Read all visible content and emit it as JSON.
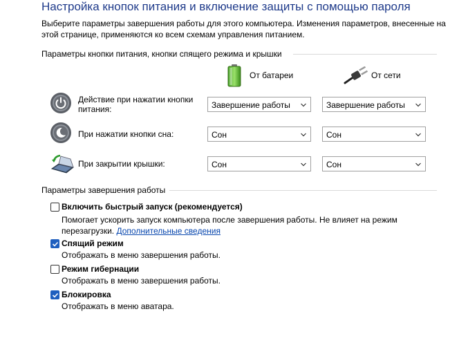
{
  "header": {
    "title": "Настройка кнопок питания и включение защиты с помощью пароля",
    "intro_line1": "Выберите параметры завершения работы для этого компьютера. Изменения параметров, внесенные на",
    "intro_line2": "этой странице, применяются ко всем схемам управления питанием."
  },
  "power_buttons": {
    "group_label": "Параметры кнопки питания, кнопки спящего режима и крышки",
    "col_battery": "От батареи",
    "col_plugged": "От сети",
    "rows": [
      {
        "label_line1": "Действие при нажатии кнопки",
        "label_line2": "питания:",
        "battery": "Завершение работы",
        "plugged": "Завершение работы",
        "icon": "power-button-icon"
      },
      {
        "label_line1": "При нажатии кнопки сна:",
        "label_line2": "",
        "battery": "Сон",
        "plugged": "Сон",
        "icon": "sleep-button-icon"
      },
      {
        "label_line1": "При закрытии крышки:",
        "label_line2": "",
        "battery": "Сон",
        "plugged": "Сон",
        "icon": "laptop-lid-icon"
      }
    ]
  },
  "shutdown": {
    "group_label": "Параметры завершения работы",
    "options": [
      {
        "title": "Включить быстрый запуск (рекомендуется)",
        "checked": false,
        "desc_line1": "Помогает ускорить запуск компьютера после завершения работы. Не влияет на режим",
        "desc_line2": "перезагрузки.",
        "link": "Дополнительные сведения"
      },
      {
        "title": "Спящий режим",
        "checked": true,
        "desc_line1": "Отображать в меню завершения работы."
      },
      {
        "title": "Режим гибернации",
        "checked": false,
        "desc_line1": "Отображать в меню завершения работы."
      },
      {
        "title": "Блокировка",
        "checked": true,
        "desc_line1": "Отображать в меню аватара."
      }
    ]
  },
  "colors": {
    "title": "#1e3a8a",
    "checkbox_on": "#1f5fbf",
    "link": "#0645ad"
  }
}
